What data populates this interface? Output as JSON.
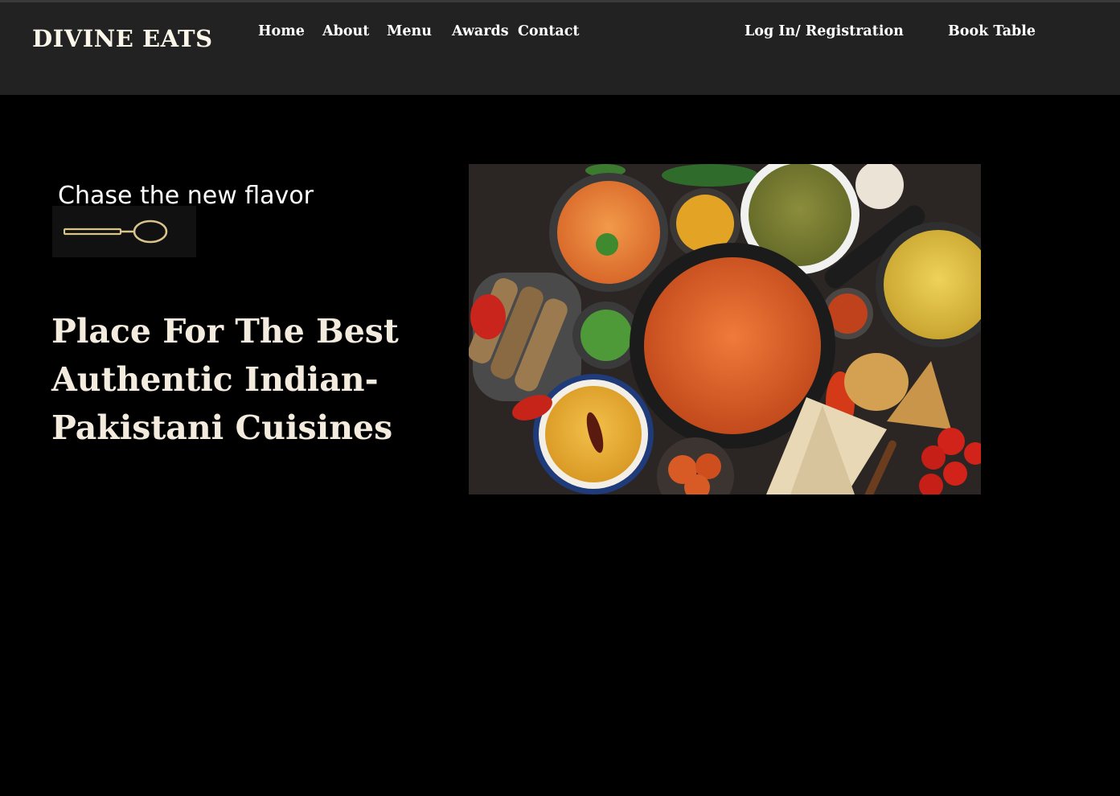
{
  "header": {
    "logo": "DIVINE EATS",
    "nav": {
      "home": "Home",
      "about": "About",
      "menu": "Menu",
      "awards": "Awards",
      "contact": "Contact",
      "login": "Log In/ Registration",
      "book": "Book Table"
    }
  },
  "hero": {
    "tagline": "Chase the new flavor",
    "headline": "Place For The Best Authentic Indian-Pakistani Cuisines",
    "image_icon": "food-spread-image"
  },
  "colors": {
    "header_bg": "#222222",
    "page_bg": "#000000",
    "headline": "#f4ebdf",
    "spoon": "#d9c48a"
  }
}
